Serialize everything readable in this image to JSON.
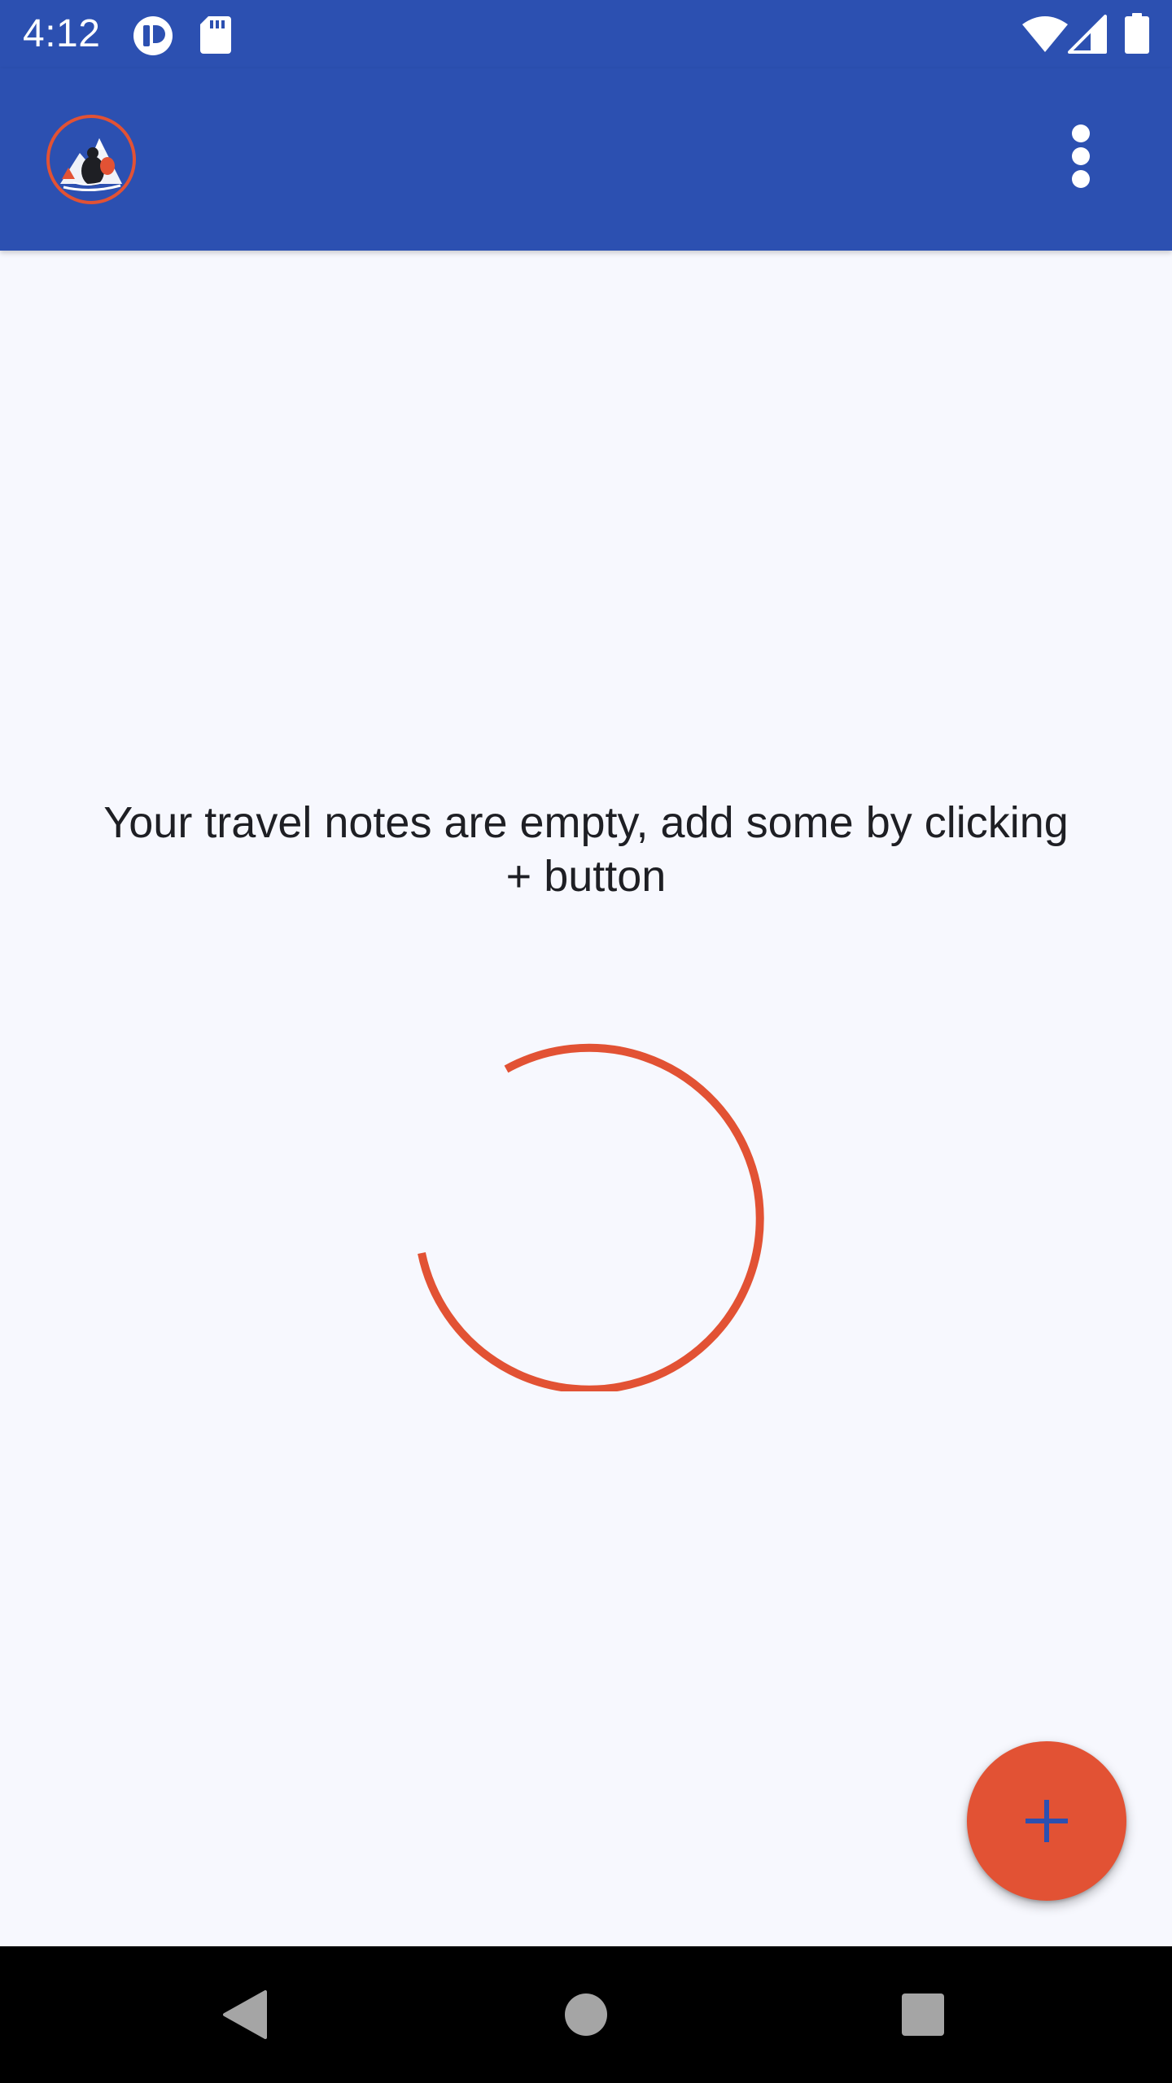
{
  "status_bar": {
    "time": "4:12",
    "icons": [
      "notification-app-icon",
      "sd-card-icon",
      "wifi-icon",
      "cell-signal-icon",
      "battery-icon"
    ]
  },
  "app_bar": {
    "logo_icon": "travel-logo-icon",
    "overflow_icon": "more-vert-icon"
  },
  "content": {
    "empty_message": "Your travel notes are empty, add some by clicking + button",
    "spinner_color": "#e25234"
  },
  "fab": {
    "icon": "add-icon",
    "background": "#e25234",
    "icon_color": "#2c50b1"
  },
  "nav_bar": {
    "icons": [
      "back-icon",
      "home-icon",
      "recents-icon"
    ]
  },
  "colors": {
    "primary": "#2c50b1",
    "accent": "#e25234",
    "background": "#f7f8fe"
  }
}
